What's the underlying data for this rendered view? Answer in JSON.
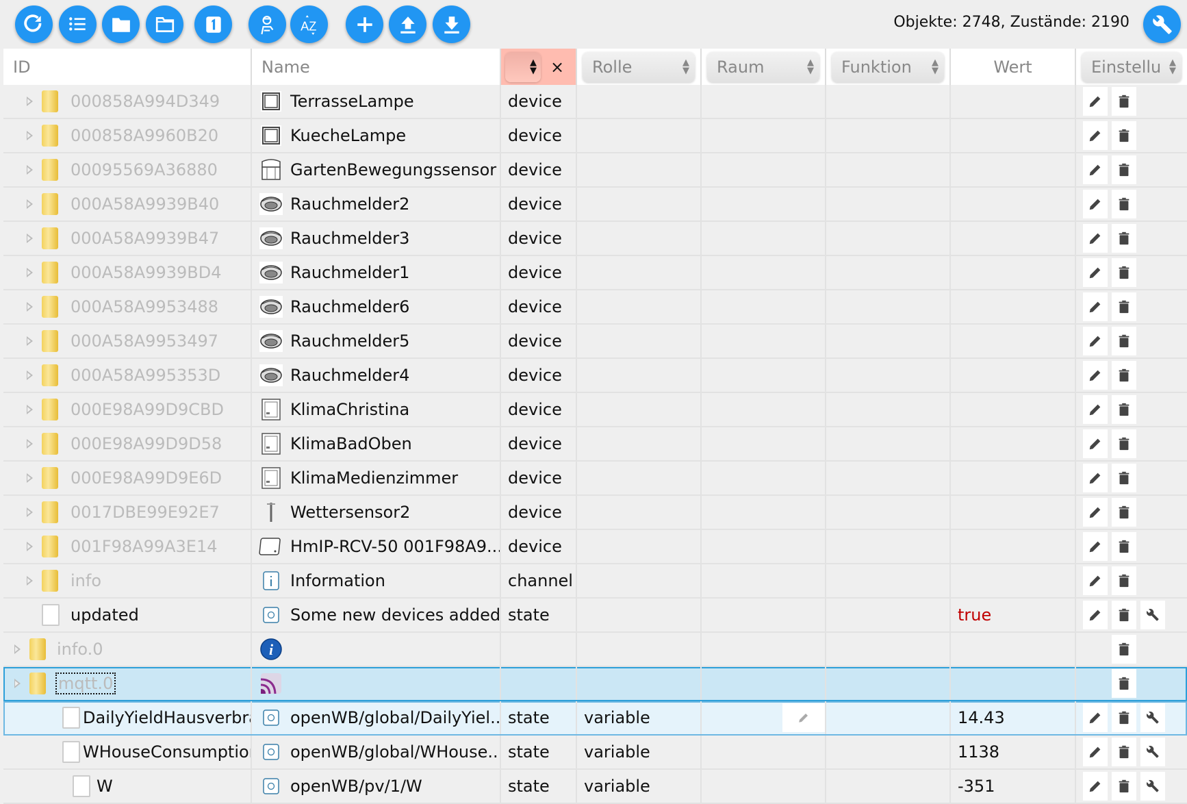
{
  "toolbar": {
    "buttons": [
      {
        "name": "refresh-button",
        "icon": "refresh-icon"
      },
      {
        "name": "list-view-button",
        "icon": "list-icon"
      },
      {
        "name": "folder-filled-button",
        "icon": "folder-icon"
      },
      {
        "name": "folder-open-button",
        "icon": "folder-outline-icon"
      },
      {
        "name": "first-level-button",
        "icon": "one-icon",
        "label": "1"
      },
      {
        "name": "expert-mode-button",
        "icon": "expert-icon"
      },
      {
        "name": "sort-az-button",
        "icon": "sort-az-icon",
        "label": "AZ"
      },
      {
        "name": "add-button",
        "icon": "plus-icon"
      },
      {
        "name": "upload-button",
        "icon": "upload-icon"
      },
      {
        "name": "download-button",
        "icon": "download-icon"
      }
    ],
    "stats": "Objekte: 2748, Zustände: 2190",
    "settings_icon": "wrench-icon"
  },
  "header": {
    "id": "ID",
    "name": "Name",
    "type_clear": "×",
    "role": "Rolle",
    "room": "Raum",
    "function": "Funktion",
    "value": "Wert",
    "settings": "Einstellu"
  },
  "colors": {
    "accent": "#2196f3",
    "true_value": "#c00000",
    "selected": "#cbe7f5",
    "active_filter": "#ffbcb0"
  },
  "rows": [
    {
      "id": "000858A994D349",
      "icon": "lamp",
      "name": "TerrasseLampe",
      "type": "device",
      "role": "",
      "value": "",
      "level": 1,
      "expand": true,
      "kind": "folder",
      "grey": true,
      "actions": [
        "edit",
        "delete"
      ]
    },
    {
      "id": "000858A9960B20",
      "icon": "lamp",
      "name": "KuecheLampe",
      "type": "device",
      "role": "",
      "value": "",
      "level": 1,
      "expand": true,
      "kind": "folder",
      "grey": true,
      "actions": [
        "edit",
        "delete"
      ]
    },
    {
      "id": "00095569A36880",
      "icon": "motion",
      "name": "GartenBewegungssensor",
      "type": "device",
      "role": "",
      "value": "",
      "level": 1,
      "expand": true,
      "kind": "folder",
      "grey": true,
      "actions": [
        "edit",
        "delete"
      ]
    },
    {
      "id": "000A58A9939B40",
      "icon": "smoke",
      "name": "Rauchmelder2",
      "type": "device",
      "role": "",
      "value": "",
      "level": 1,
      "expand": true,
      "kind": "folder",
      "grey": true,
      "actions": [
        "edit",
        "delete"
      ]
    },
    {
      "id": "000A58A9939B47",
      "icon": "smoke",
      "name": "Rauchmelder3",
      "type": "device",
      "role": "",
      "value": "",
      "level": 1,
      "expand": true,
      "kind": "folder",
      "grey": true,
      "actions": [
        "edit",
        "delete"
      ]
    },
    {
      "id": "000A58A9939BD4",
      "icon": "smoke",
      "name": "Rauchmelder1",
      "type": "device",
      "role": "",
      "value": "",
      "level": 1,
      "expand": true,
      "kind": "folder",
      "grey": true,
      "actions": [
        "edit",
        "delete"
      ]
    },
    {
      "id": "000A58A9953488",
      "icon": "smoke",
      "name": "Rauchmelder6",
      "type": "device",
      "role": "",
      "value": "",
      "level": 1,
      "expand": true,
      "kind": "folder",
      "grey": true,
      "actions": [
        "edit",
        "delete"
      ]
    },
    {
      "id": "000A58A9953497",
      "icon": "smoke",
      "name": "Rauchmelder5",
      "type": "device",
      "role": "",
      "value": "",
      "level": 1,
      "expand": true,
      "kind": "folder",
      "grey": true,
      "actions": [
        "edit",
        "delete"
      ]
    },
    {
      "id": "000A58A995353D",
      "icon": "smoke",
      "name": "Rauchmelder4",
      "type": "device",
      "role": "",
      "value": "",
      "level": 1,
      "expand": true,
      "kind": "folder",
      "grey": true,
      "actions": [
        "edit",
        "delete"
      ]
    },
    {
      "id": "000E98A99D9CBD",
      "icon": "thermostat",
      "name": "KlimaChristina",
      "type": "device",
      "role": "",
      "value": "",
      "level": 1,
      "expand": true,
      "kind": "folder",
      "grey": true,
      "actions": [
        "edit",
        "delete"
      ]
    },
    {
      "id": "000E98A99D9D58",
      "icon": "thermostat",
      "name": "KlimaBadOben",
      "type": "device",
      "role": "",
      "value": "",
      "level": 1,
      "expand": true,
      "kind": "folder",
      "grey": true,
      "actions": [
        "edit",
        "delete"
      ]
    },
    {
      "id": "000E98A99D9E6D",
      "icon": "thermostat",
      "name": "KlimaMedienzimmer",
      "type": "device",
      "role": "",
      "value": "",
      "level": 1,
      "expand": true,
      "kind": "folder",
      "grey": true,
      "actions": [
        "edit",
        "delete"
      ]
    },
    {
      "id": "0017DBE99E92E7",
      "icon": "weather",
      "name": "Wettersensor2",
      "type": "device",
      "role": "",
      "value": "",
      "level": 1,
      "expand": true,
      "kind": "folder",
      "grey": true,
      "actions": [
        "edit",
        "delete"
      ]
    },
    {
      "id": "001F98A99A3E14",
      "icon": "box",
      "name": "HmIP-RCV-50 001F98A9...",
      "type": "device",
      "role": "",
      "value": "",
      "level": 1,
      "expand": true,
      "kind": "folder",
      "grey": true,
      "actions": [
        "edit",
        "delete"
      ]
    },
    {
      "id": "info",
      "icon": "info-small",
      "name": "Information",
      "type": "channel",
      "role": "",
      "value": "",
      "level": 1,
      "expand": true,
      "kind": "folder",
      "grey": true,
      "actions": [
        "edit",
        "delete"
      ]
    },
    {
      "id": "updated",
      "icon": "state",
      "name": "Some new devices added",
      "type": "state",
      "role": "",
      "value": "true",
      "value_color": "#c00000",
      "level": 1,
      "expand": false,
      "kind": "file",
      "grey": false,
      "actions": [
        "edit",
        "delete",
        "settings"
      ]
    },
    {
      "id": "info.0",
      "icon": "info-blue",
      "name": "",
      "type": "",
      "role": "",
      "value": "",
      "level": 0,
      "expand": true,
      "kind": "folder",
      "grey": true,
      "actions": [
        "delete"
      ]
    },
    {
      "id": "mqtt.0",
      "icon": "mqtt",
      "name": "",
      "type": "",
      "role": "",
      "value": "",
      "level": 0,
      "expand": true,
      "kind": "folder",
      "grey": true,
      "selected": true,
      "focus": true,
      "actions": [
        "delete"
      ]
    },
    {
      "id": "DailyYieldHausverbrauch",
      "icon": "state",
      "name": "openWB/global/DailyYiel...",
      "type": "state",
      "role": "variable",
      "value": "14.43",
      "level": 2,
      "expand": false,
      "kind": "file",
      "grey": false,
      "highlight": true,
      "room_edit": true,
      "actions": [
        "edit",
        "delete",
        "settings"
      ]
    },
    {
      "id": "WHouseConsumption",
      "icon": "state",
      "name": "openWB/global/WHouse...",
      "type": "state",
      "role": "variable",
      "value": "1138",
      "level": 2,
      "expand": false,
      "kind": "file",
      "grey": false,
      "actions": [
        "edit",
        "delete",
        "settings"
      ]
    },
    {
      "id": "W",
      "icon": "state",
      "name": "openWB/pv/1/W",
      "type": "state",
      "role": "variable",
      "value": "-351",
      "level": 3,
      "expand": false,
      "kind": "file",
      "grey": false,
      "actions": [
        "edit",
        "delete",
        "settings"
      ]
    }
  ]
}
